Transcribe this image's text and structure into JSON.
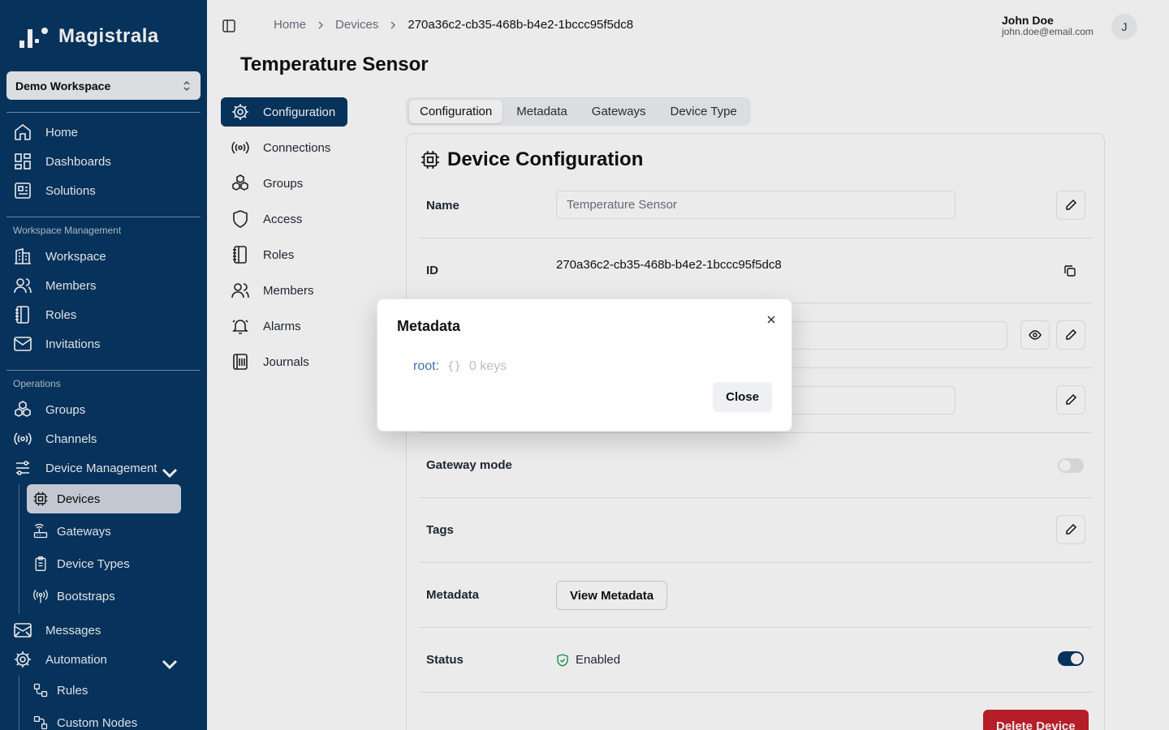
{
  "app": {
    "name": "Magistrala"
  },
  "workspace": {
    "selected": "Demo Workspace"
  },
  "sidebar": {
    "main": [
      {
        "label": "Home",
        "icon": "home-icon"
      },
      {
        "label": "Dashboards",
        "icon": "dashboards-icon"
      },
      {
        "label": "Solutions",
        "icon": "solutions-icon"
      }
    ],
    "workspace_section": "Workspace Management",
    "workspace_items": [
      {
        "label": "Workspace",
        "icon": "building-icon"
      },
      {
        "label": "Members",
        "icon": "users-icon"
      },
      {
        "label": "Roles",
        "icon": "roles-icon"
      },
      {
        "label": "Invitations",
        "icon": "mail-icon"
      }
    ],
    "operations_section": "Operations",
    "operations_items": [
      {
        "label": "Groups",
        "icon": "groups-icon"
      },
      {
        "label": "Channels",
        "icon": "channels-icon"
      },
      {
        "label": "Device Management",
        "icon": "sliders-icon"
      }
    ],
    "device_sub": [
      {
        "label": "Devices",
        "icon": "chip-icon",
        "active": true
      },
      {
        "label": "Gateways",
        "icon": "router-icon"
      },
      {
        "label": "Device Types",
        "icon": "clipboard-icon"
      },
      {
        "label": "Bootstraps",
        "icon": "broadcast-icon"
      }
    ],
    "messages": "Messages",
    "automation": "Automation",
    "automation_sub": [
      {
        "label": "Rules",
        "icon": "workflow-icon"
      },
      {
        "label": "Custom Nodes",
        "icon": "nodes-icon"
      }
    ]
  },
  "breadcrumb": [
    "Home",
    "Devices",
    "270a36c2-cb35-468b-b4e2-1bccc95f5dc8"
  ],
  "user": {
    "name": "John Doe",
    "email": "john.doe@email.com",
    "initial": "J"
  },
  "page_title": "Temperature Sensor",
  "secondary_nav": [
    {
      "label": "Configuration",
      "icon": "gear-icon",
      "active": true
    },
    {
      "label": "Connections",
      "icon": "broadcast-icon"
    },
    {
      "label": "Groups",
      "icon": "groups-icon"
    },
    {
      "label": "Access",
      "icon": "shield-icon"
    },
    {
      "label": "Roles",
      "icon": "roles-icon"
    },
    {
      "label": "Members",
      "icon": "users-icon"
    },
    {
      "label": "Alarms",
      "icon": "bell-icon"
    },
    {
      "label": "Journals",
      "icon": "journal-icon"
    }
  ],
  "tabs": [
    "Configuration",
    "Metadata",
    "Gateways",
    "Device Type"
  ],
  "card": {
    "title": "Device Configuration",
    "name_label": "Name",
    "name_value": "Temperature Sensor",
    "id_label": "ID",
    "id_value": "270a36c2-cb35-468b-b4e2-1bccc95f5dc8",
    "gateway_label": "Gateway mode",
    "tags_label": "Tags",
    "metadata_label": "Metadata",
    "view_metadata": "View Metadata",
    "status_label": "Status",
    "status_value": "Enabled",
    "gateway_mode_on": false,
    "status_on": true,
    "delete_label": "Delete Device"
  },
  "modal": {
    "title": "Metadata",
    "root_label": "root:",
    "brace": "{}",
    "key_count": "0 keys",
    "close_label": "Close"
  },
  "colors": {
    "sidebar_bg": "#073763",
    "accent": "#073763",
    "danger": "#c5202c"
  }
}
